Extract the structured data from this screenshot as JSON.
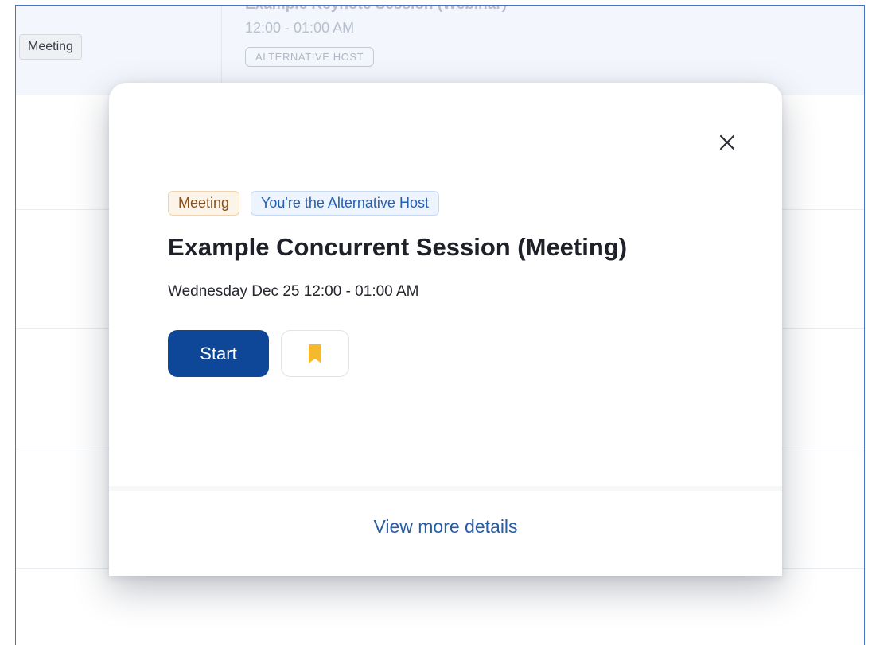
{
  "background": {
    "chip_meeting": "Meeting",
    "event_title": "Example Keynote Session (Webinar)",
    "event_time": "12:00 - 01:00 AM",
    "event_badge": "ALTERNATIVE HOST"
  },
  "modal": {
    "tags": {
      "meeting": "Meeting",
      "alt_host": "You're the Alternative Host"
    },
    "title": "Example Concurrent Session (Meeting)",
    "datetime": "Wednesday Dec 25 12:00 - 01:00 AM",
    "start_label": "Start",
    "footer_link": "View more details"
  },
  "colors": {
    "primary": "#0e4797",
    "link": "#2a5ca4",
    "bookmark": "#f5b92e",
    "tag_meeting_text": "#8a5018",
    "tag_alt_host_text": "#255fb0"
  },
  "icons": {
    "close": "close-icon",
    "bookmark": "bookmark-icon"
  }
}
